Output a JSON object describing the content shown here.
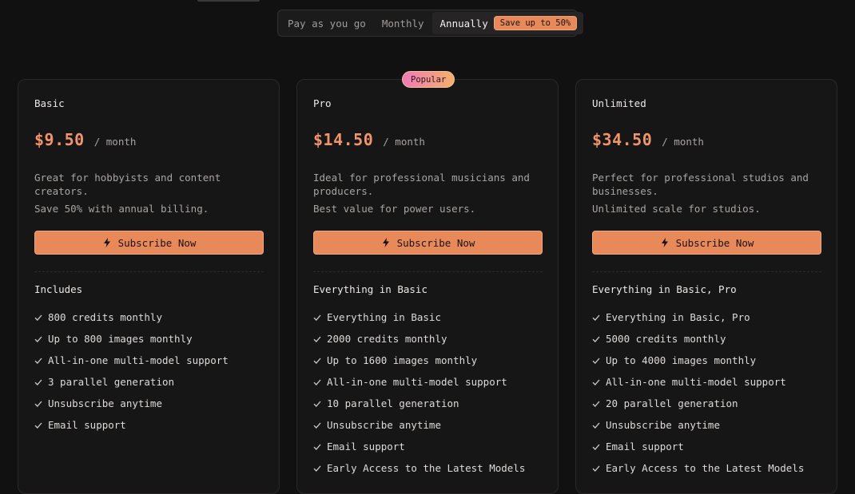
{
  "billing": {
    "options": [
      "Pay as you go",
      "Monthly",
      "Annually"
    ],
    "selected": "Annually",
    "save_badge": "Save up to 50%"
  },
  "colors": {
    "accent": "#e8895a",
    "price": "#f0956a",
    "background": "#121112",
    "card": "#171617"
  },
  "plans": [
    {
      "name": "Basic",
      "price": "$9.50",
      "period": "/ month",
      "description": "Great for hobbyists and content creators.",
      "description2": "Save 50% with annual billing.",
      "cta": "Subscribe Now",
      "includes_title": "Includes",
      "features": [
        "800 credits monthly",
        "Up to 800 images monthly",
        "All-in-one multi-model support",
        "3 parallel generation",
        "Unsubscribe anytime",
        "Email support"
      ]
    },
    {
      "name": "Pro",
      "badge": "Popular",
      "price": "$14.50",
      "period": "/ month",
      "description": "Ideal for professional musicians and producers.",
      "description2": "Best value for power users.",
      "cta": "Subscribe Now",
      "includes_title": "Everything in Basic",
      "features": [
        "Everything in Basic",
        "2000 credits monthly",
        "Up to 1600 images monthly",
        "All-in-one multi-model support",
        "10 parallel generation",
        "Unsubscribe anytime",
        "Email support",
        "Early Access to the Latest Models"
      ]
    },
    {
      "name": "Unlimited",
      "price": "$34.50",
      "period": "/ month",
      "description": "Perfect for professional studios and businesses.",
      "description2": "Unlimited scale for studios.",
      "cta": "Subscribe Now",
      "includes_title": "Everything in Basic, Pro",
      "features": [
        "Everything in Basic, Pro",
        "5000 credits monthly",
        "Up to 4000 images monthly",
        "All-in-one multi-model support",
        "20 parallel generation",
        "Unsubscribe anytime",
        "Email support",
        "Early Access to the Latest Models"
      ]
    }
  ]
}
